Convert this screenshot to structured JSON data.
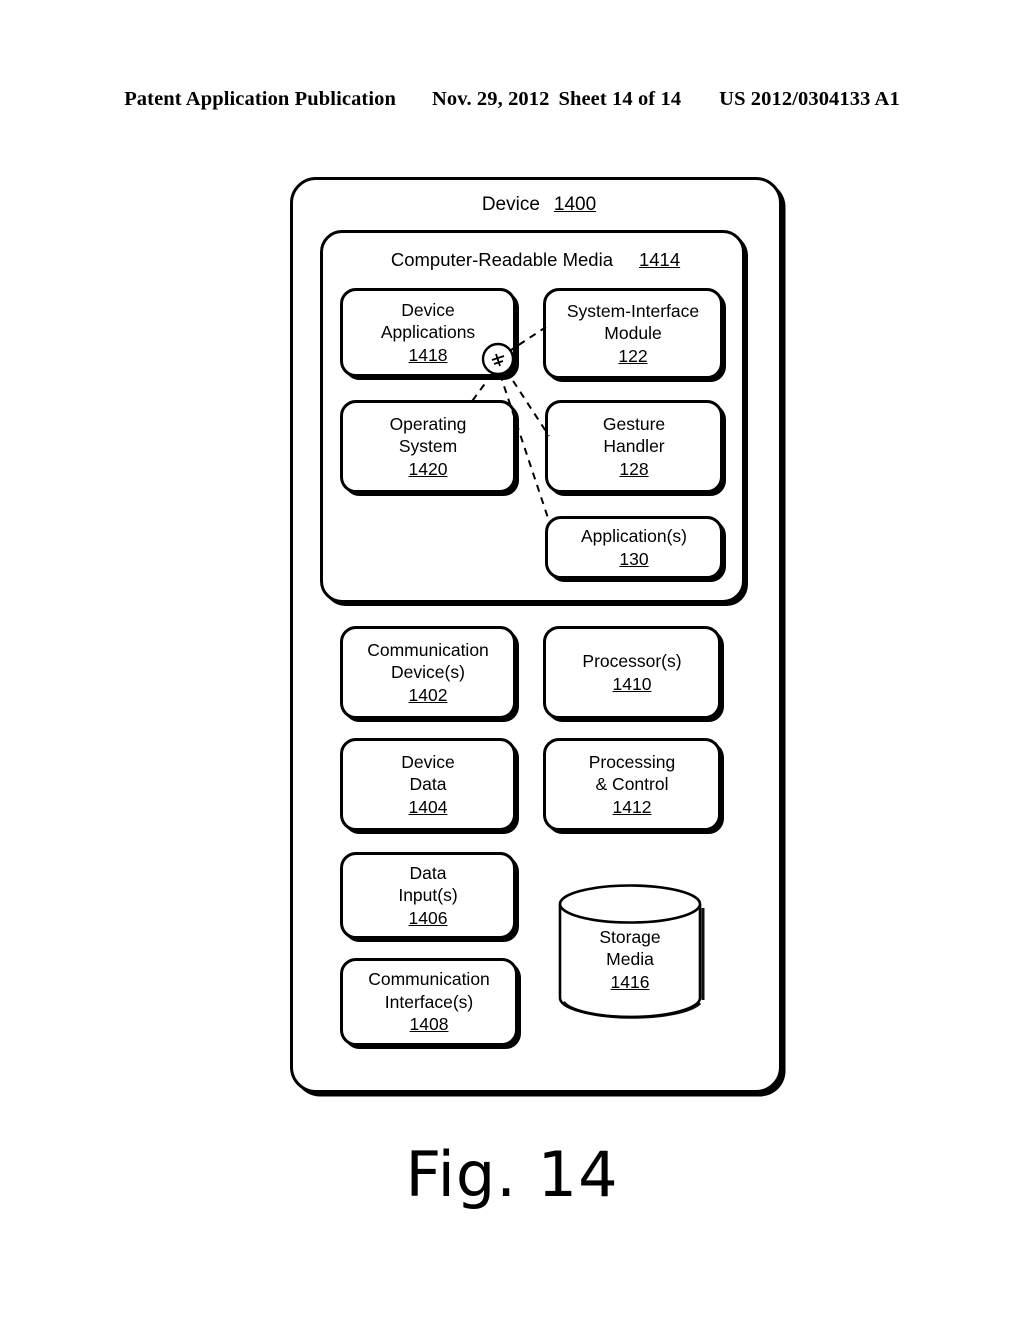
{
  "header": {
    "publication": "Patent Application Publication",
    "date": "Nov. 29, 2012",
    "sheet": "Sheet 14 of 14",
    "patent_number": "US 2012/0304133 A1"
  },
  "figure": {
    "caption": "Fig. 14",
    "device": {
      "label": "Device",
      "ref": "1400"
    },
    "computer_readable_media": {
      "label": "Computer-Readable Media",
      "ref": "1414"
    },
    "modules": [
      {
        "id": "device-applications",
        "lines": [
          "Device",
          "Applications"
        ],
        "ref": "1418"
      },
      {
        "id": "system-interface-module",
        "lines": [
          "System-Interface",
          "Module"
        ],
        "ref": "122"
      },
      {
        "id": "operating-system",
        "lines": [
          "Operating",
          "System"
        ],
        "ref": "1420"
      },
      {
        "id": "gesture-handler",
        "lines": [
          "Gesture",
          "Handler"
        ],
        "ref": "128"
      },
      {
        "id": "applications",
        "lines": [
          "Application(s)"
        ],
        "ref": "130"
      },
      {
        "id": "communication-devices",
        "lines": [
          "Communication",
          "Device(s)"
        ],
        "ref": "1402"
      },
      {
        "id": "processors",
        "lines": [
          "Processor(s)"
        ],
        "ref": "1410"
      },
      {
        "id": "device-data",
        "lines": [
          "Device",
          "Data"
        ],
        "ref": "1404"
      },
      {
        "id": "processing-and-control",
        "lines": [
          "Processing",
          "& Control"
        ],
        "ref": "1412"
      },
      {
        "id": "data-inputs",
        "lines": [
          "Data",
          "Input(s)"
        ],
        "ref": "1406"
      },
      {
        "id": "communication-interfaces",
        "lines": [
          "Communication",
          "Interface(s)"
        ],
        "ref": "1408"
      },
      {
        "id": "storage-media",
        "lines": [
          "Storage",
          "Media"
        ],
        "ref": "1416"
      }
    ],
    "colors": {
      "stroke": "#000000",
      "background": "#ffffff"
    }
  }
}
